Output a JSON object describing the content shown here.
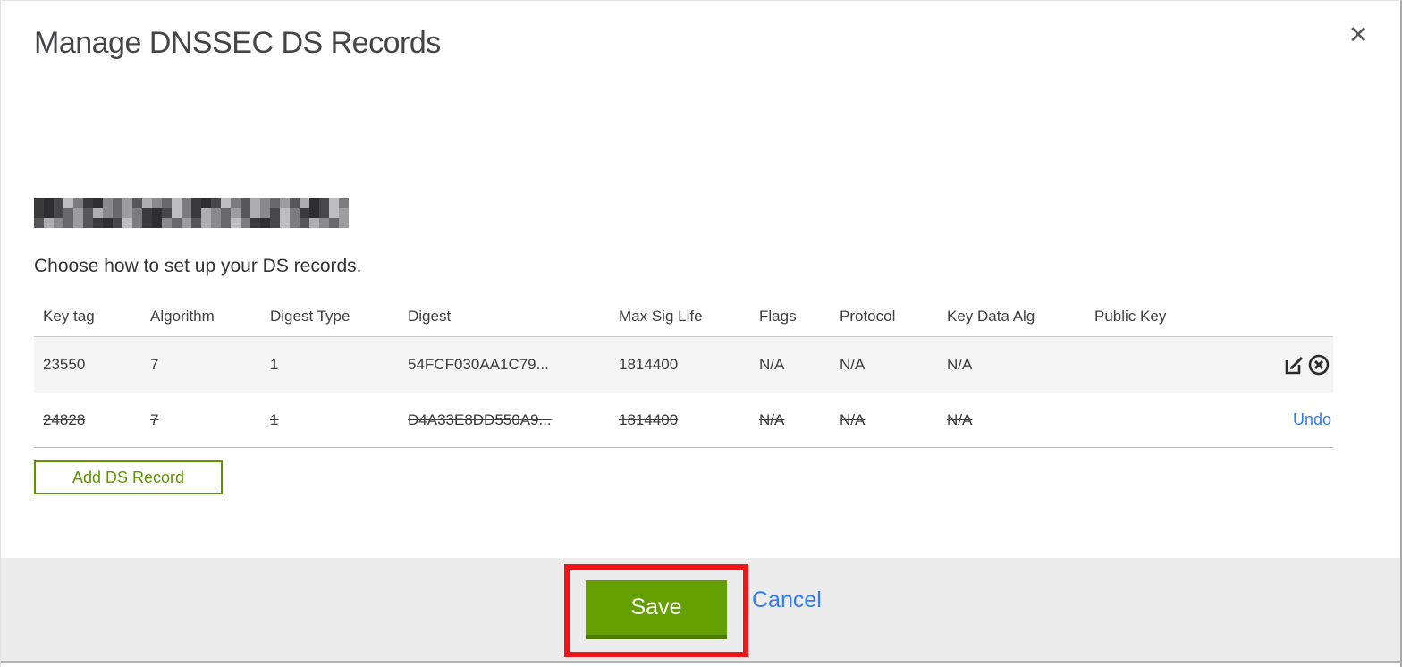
{
  "modal": {
    "title": "Manage DNSSEC DS Records",
    "close_icon": "✕",
    "subtitle": "Choose how to set up your DS records.",
    "domain_redacted": true
  },
  "table": {
    "columns": {
      "key_tag": "Key tag",
      "algorithm": "Algorithm",
      "digest_type": "Digest Type",
      "digest": "Digest",
      "max_sig_life": "Max Sig Life",
      "flags": "Flags",
      "protocol": "Protocol",
      "key_data_alg": "Key Data Alg",
      "public_key": "Public Key"
    },
    "rows": [
      {
        "key_tag": "23550",
        "algorithm": "7",
        "digest_type": "1",
        "digest": "54FCF030AA1C79...",
        "max_sig_life": "1814400",
        "flags": "N/A",
        "protocol": "N/A",
        "key_data_alg": "N/A",
        "public_key": "",
        "state": "normal",
        "actions": [
          "edit",
          "delete"
        ]
      },
      {
        "key_tag": "24828",
        "algorithm": "7",
        "digest_type": "1",
        "digest": "D4A33E8DD550A9...",
        "max_sig_life": "1814400",
        "flags": "N/A",
        "protocol": "N/A",
        "key_data_alg": "N/A",
        "public_key": "",
        "state": "deleted",
        "undo_label": "Undo"
      }
    ]
  },
  "buttons": {
    "add_ds_record": "Add DS Record",
    "save": "Save",
    "cancel": "Cancel"
  },
  "colors": {
    "green": "#63a000",
    "green_border": "#4d7c00",
    "link_blue": "#2f7cf6",
    "annotation_red": "#ee1616",
    "row_shade": "#f5f5f5",
    "footer_gray": "#ececec"
  }
}
